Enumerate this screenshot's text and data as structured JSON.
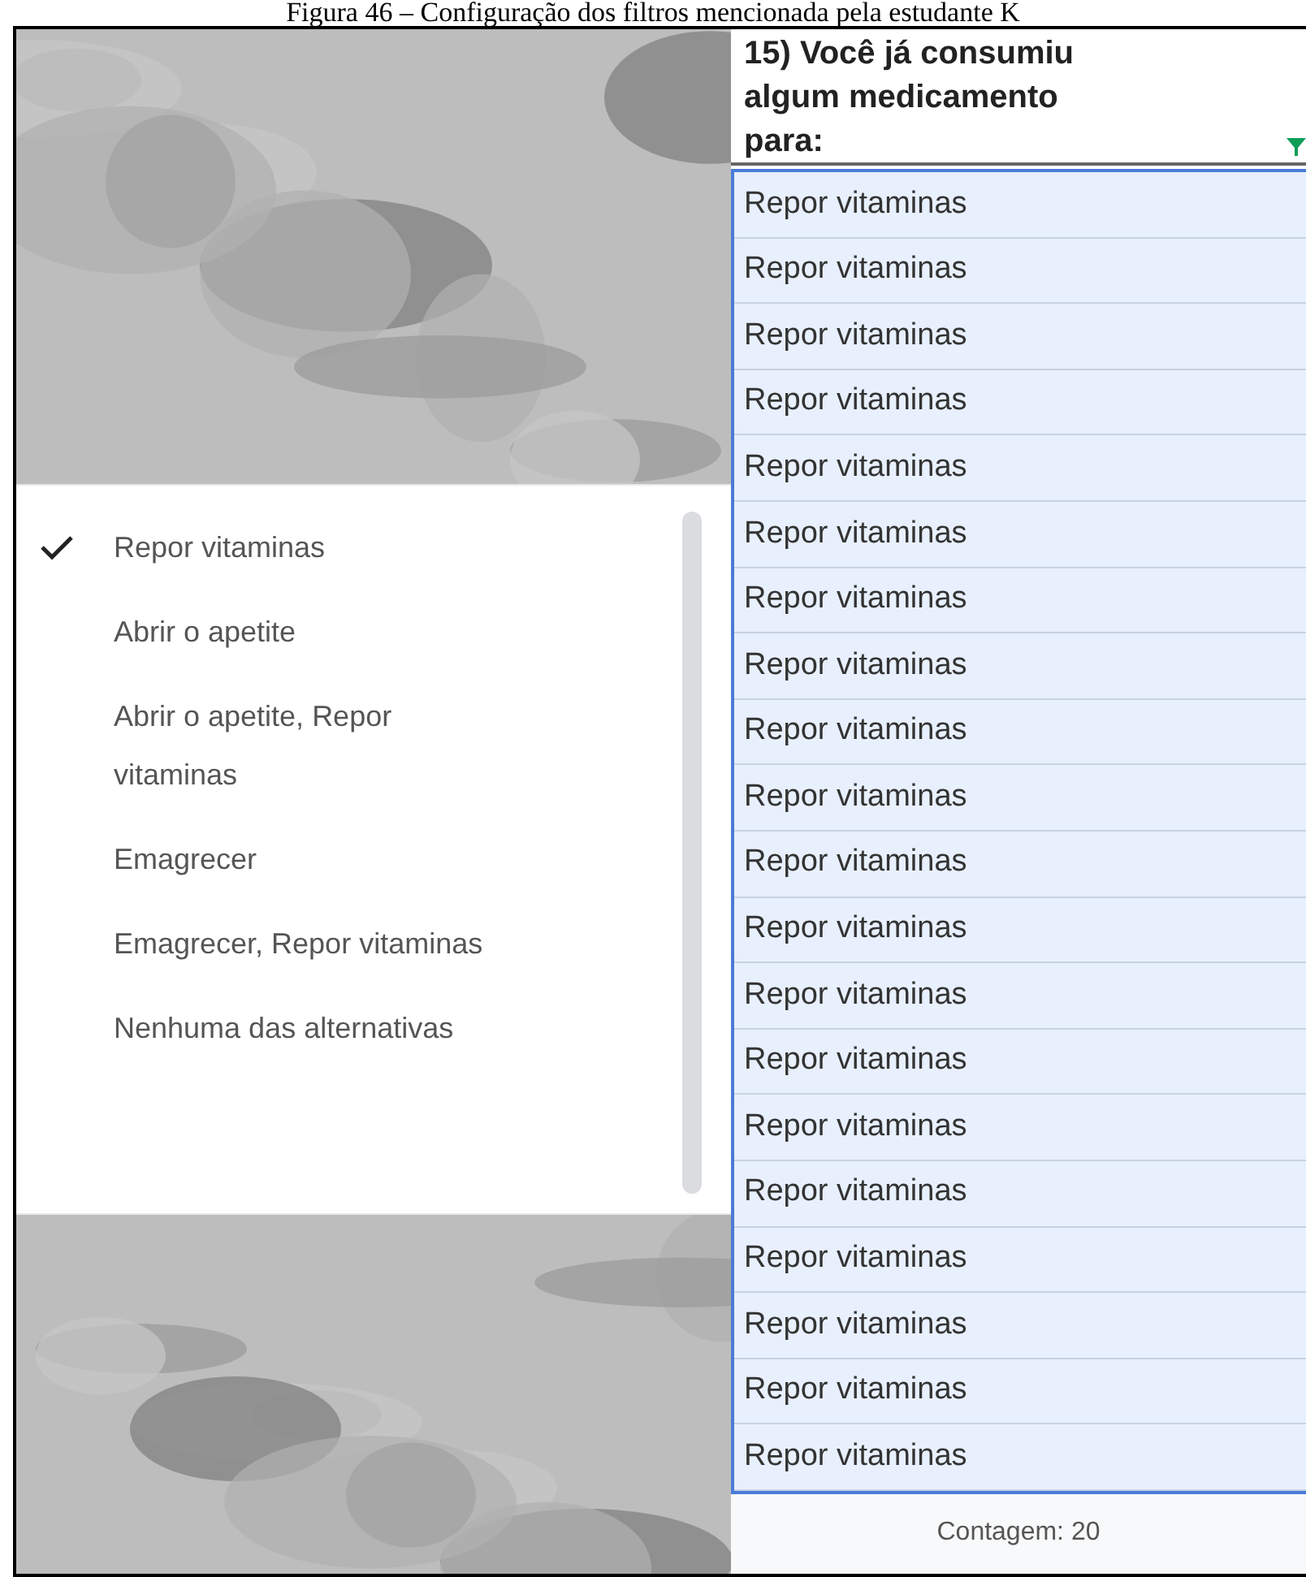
{
  "caption": "Figura 46 – Configuração dos filtros mencionada pela estudante K",
  "filter_menu": {
    "items": [
      {
        "label": "Repor vitaminas",
        "selected": true
      },
      {
        "label": "Abrir o apetite",
        "selected": false
      },
      {
        "label": "Abrir o apetite, Repor vitaminas",
        "selected": false
      },
      {
        "label": "Emagrecer",
        "selected": false
      },
      {
        "label": "Emagrecer, Repor vitaminas",
        "selected": false
      },
      {
        "label": "Nenhuma das alternativas",
        "selected": false
      }
    ]
  },
  "column": {
    "header": "15) Você já consumiu algum medicamento para:",
    "cells": [
      "Repor vitaminas",
      "Repor vitaminas",
      "Repor vitaminas",
      "Repor vitaminas",
      "Repor vitaminas",
      "Repor vitaminas",
      "Repor vitaminas",
      "Repor vitaminas",
      "Repor vitaminas",
      "Repor vitaminas",
      "Repor vitaminas",
      "Repor vitaminas",
      "Repor vitaminas",
      "Repor vitaminas",
      "Repor vitaminas",
      "Repor vitaminas",
      "Repor vitaminas",
      "Repor vitaminas",
      "Repor vitaminas",
      "Repor vitaminas"
    ]
  },
  "status_bar": {
    "count": "Contagem: 20"
  }
}
